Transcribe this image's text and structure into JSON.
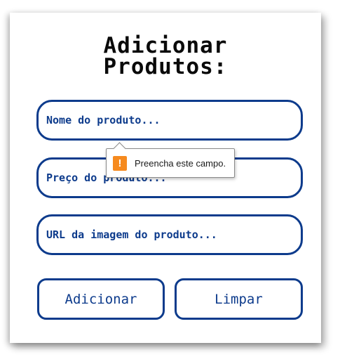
{
  "form": {
    "title_line1": "Adicionar",
    "title_line2": "Produtos:",
    "name_placeholder": "Nome do produto...",
    "price_placeholder": "Preço do produto...",
    "url_placeholder": "URL da imagem do produto...",
    "add_label": "Adicionar",
    "clear_label": "Limpar"
  },
  "validation_tooltip": {
    "icon": "warning-icon",
    "icon_glyph": "!",
    "message": "Preencha este campo."
  },
  "colors": {
    "accent": "#0d3b8c",
    "warning": "#f68a1e"
  }
}
